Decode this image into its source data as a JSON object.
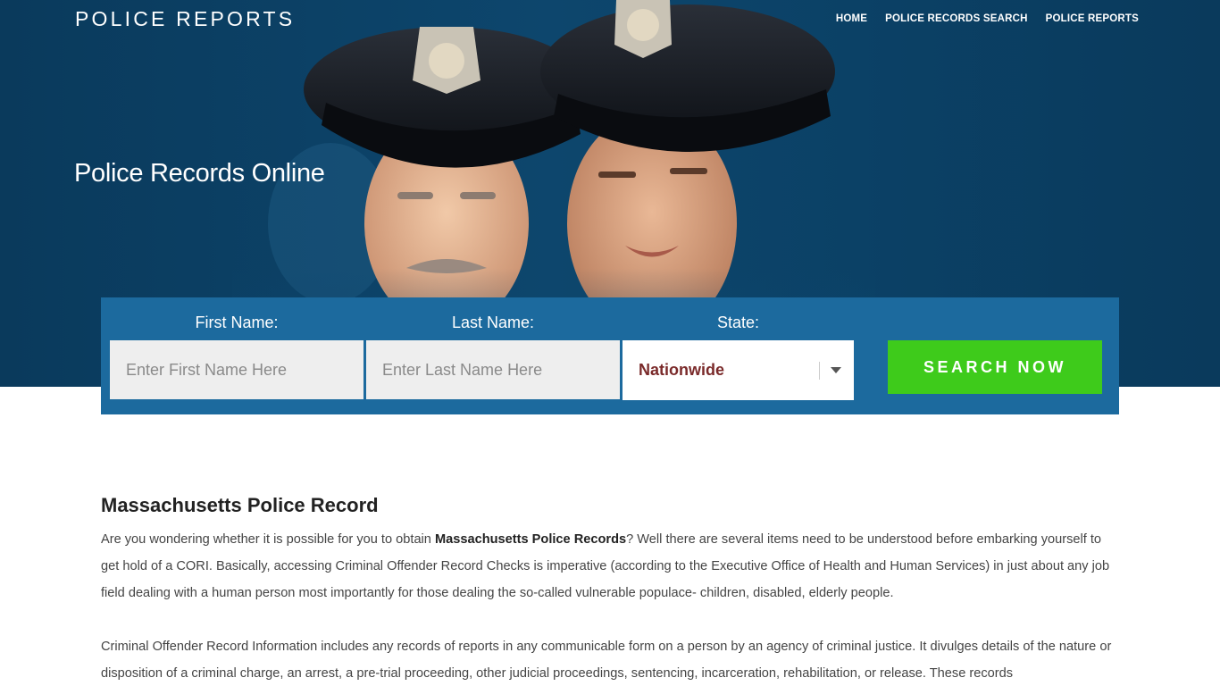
{
  "brand": "POLICE REPORTS",
  "nav": {
    "items": [
      "HOME",
      "POLICE RECORDS SEARCH",
      "POLICE REPORTS"
    ]
  },
  "hero": {
    "title": "Police Records Online"
  },
  "search": {
    "first_name_label": "First Name:",
    "first_name_placeholder": "Enter First Name Here",
    "last_name_label": "Last Name:",
    "last_name_placeholder": "Enter Last Name Here",
    "state_label": "State:",
    "state_value": "Nationwide",
    "button_label": "SEARCH NOW"
  },
  "article": {
    "heading": "Massachusetts Police Record",
    "p1_before": "Are you wondering whether it is possible for you to obtain ",
    "p1_bold": "Massachusetts Police Records",
    "p1_after": "?  Well there are several items need to be understood before embarking yourself to get hold of a CORI.  Basically, accessing Criminal Offender Record Checks is imperative (according to the Executive Office of Health and Human Services) in just about any job field dealing with a human person most importantly for those dealing the so-called vulnerable populace- children, disabled, elderly people.",
    "p2": "Criminal Offender Record Information includes any records of reports in any communicable form on a person by an agency of criminal justice.  It divulges details of the nature or disposition of a criminal charge, an arrest, a pre-trial proceeding, other judicial proceedings, sentencing, incarceration, rehabilitation, or release.  These records"
  },
  "colors": {
    "hero_bg": "#0d466d",
    "panel_bg": "#1c6a9e",
    "button_bg": "#3ecb1b",
    "state_text": "#7a2a2a"
  }
}
